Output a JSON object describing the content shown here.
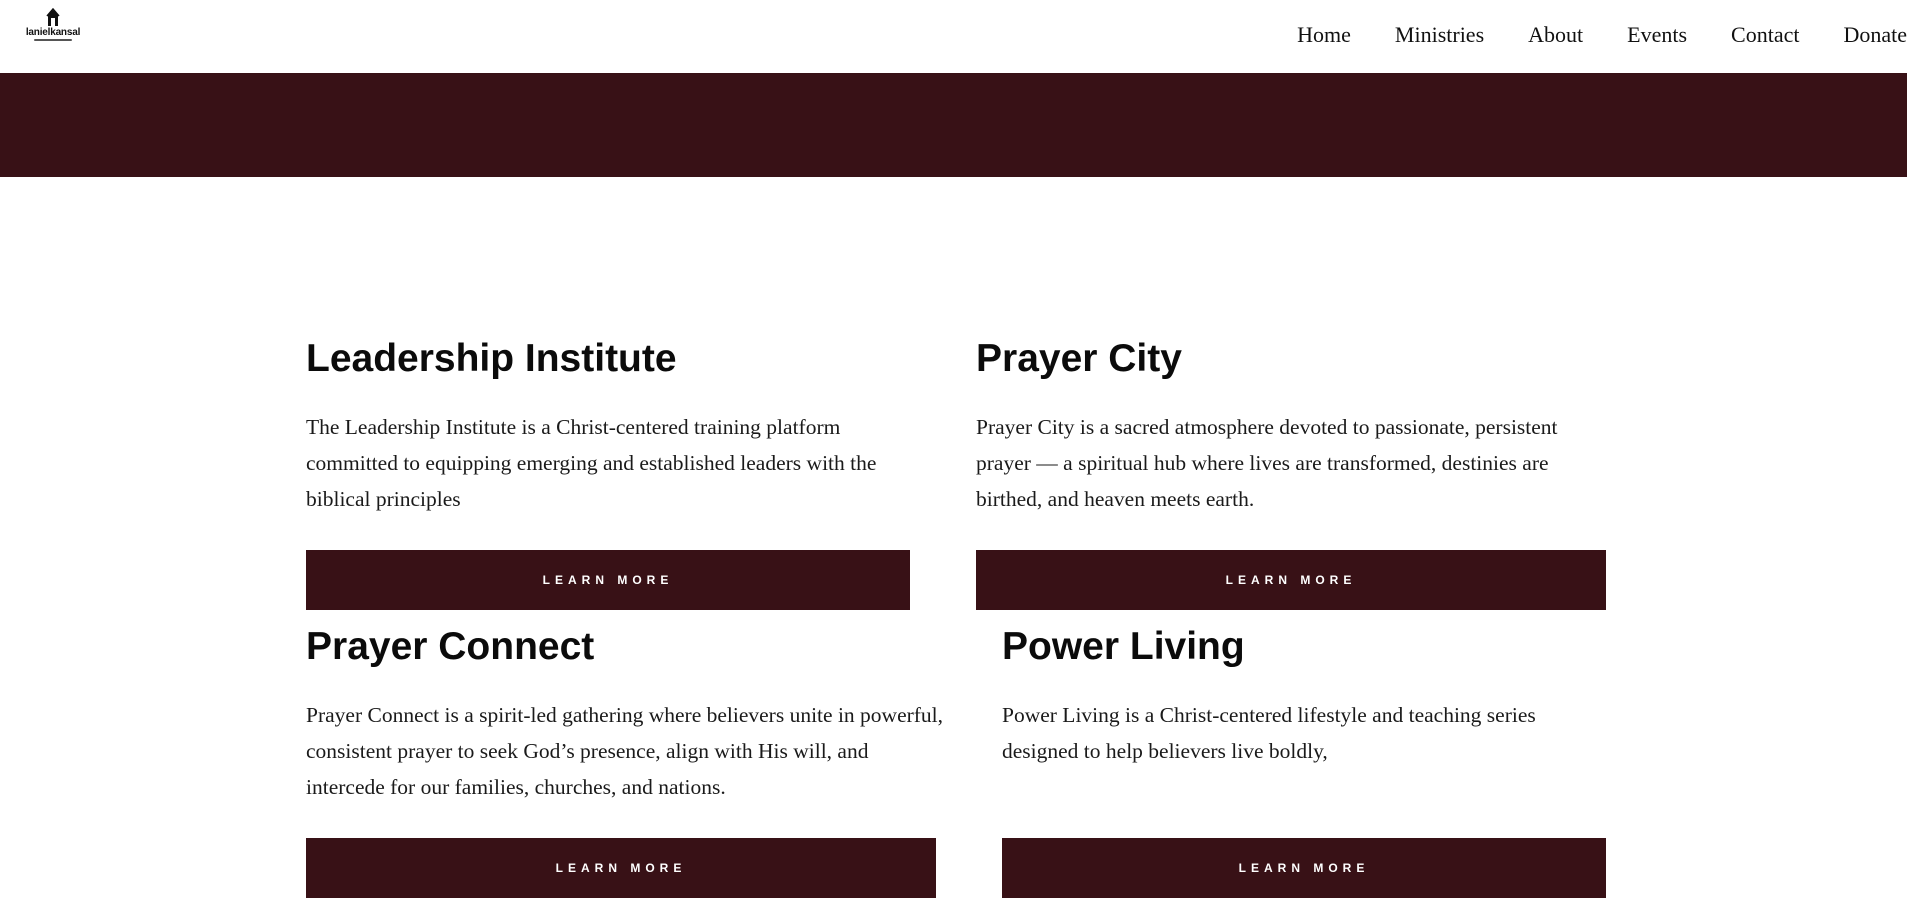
{
  "header": {
    "logo_text": "lanielkansal",
    "nav": [
      "Home",
      "Ministries",
      "About",
      "Events",
      "Contact",
      "Donate"
    ]
  },
  "colors": {
    "brand": "#381116",
    "background": "#ffffff",
    "text": "#111111"
  },
  "ministries": [
    {
      "title": "Leadership Institute",
      "description": "The Leadership Institute is a Christ-centered training platform committed to equipping emerging and established leaders with the biblical principles",
      "button": "LEARN MORE"
    },
    {
      "title": "Prayer City",
      "description": "Prayer City is a sacred atmosphere devoted to passionate, persistent prayer — a spiritual hub where lives are transformed, destinies are birthed, and heaven meets earth.",
      "button": "LEARN MORE"
    },
    {
      "title": "Prayer Connect",
      "description": "Prayer Connect is a spirit-led gathering where believers unite in powerful, consistent prayer to seek God’s presence, align with His will, and intercede for our families, churches, and nations.",
      "button": "LEARN MORE"
    },
    {
      "title": "Power Living",
      "description": "Power Living is a Christ-centered lifestyle and teaching series designed to help believers live boldly,",
      "button": "LEARN MORE"
    }
  ]
}
